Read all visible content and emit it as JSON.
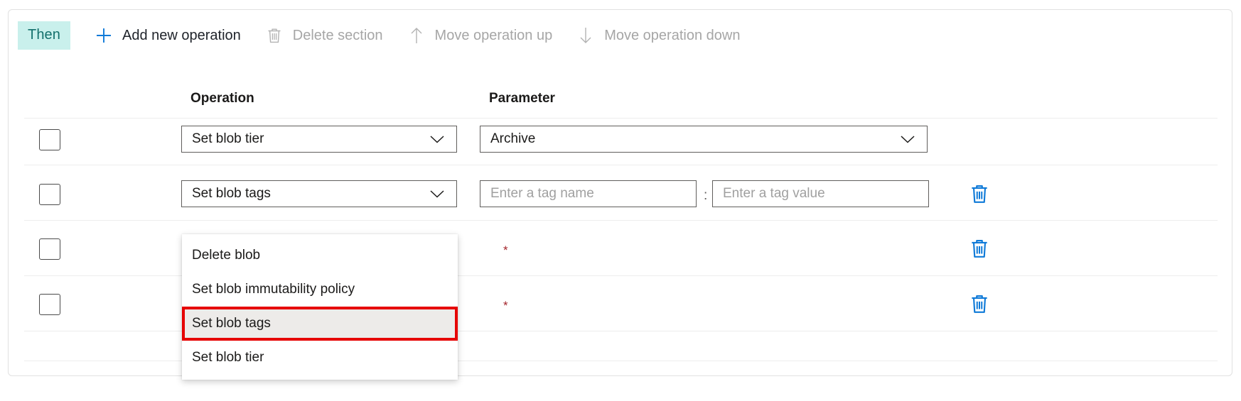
{
  "section": {
    "badge_label": "Then"
  },
  "toolbar": {
    "items": [
      {
        "label": "Add new operation",
        "icon": "plus-icon",
        "enabled": true
      },
      {
        "label": "Delete section",
        "icon": "trash-icon",
        "enabled": false
      },
      {
        "label": "Move operation up",
        "icon": "arrow-up-icon",
        "enabled": false
      },
      {
        "label": "Move operation down",
        "icon": "arrow-down-icon",
        "enabled": false
      }
    ]
  },
  "grid": {
    "columns": [
      "Operation",
      "Parameter"
    ],
    "required_marker": "*",
    "tag_separator": ":",
    "rows": [
      {
        "operation": "Set blob tier",
        "parameter_kind": "dropdown",
        "parameter_value": "Archive",
        "has_delete": false
      },
      {
        "operation": "Set blob tags",
        "parameter_kind": "tag-pair",
        "tag_name_placeholder": "Enter a tag name",
        "tag_value_placeholder": "Enter a tag value",
        "has_delete": true
      },
      {
        "operation": "",
        "parameter_kind": "hidden",
        "has_delete": true
      },
      {
        "operation": "",
        "parameter_kind": "hidden",
        "has_delete": true
      }
    ]
  },
  "operation_dropdown": {
    "open": true,
    "selected": "Set blob tags",
    "options": [
      "Delete blob",
      "Set blob immutability policy",
      "Set blob tags",
      "Set blob tier"
    ]
  },
  "colors": {
    "badge_background": "#c9f0ec",
    "badge_text": "#13706c",
    "accent_blue": "#0f7ad8",
    "required_red": "#a4262c",
    "highlight_red": "#e60000",
    "selected_row_background": "#edebe9"
  }
}
